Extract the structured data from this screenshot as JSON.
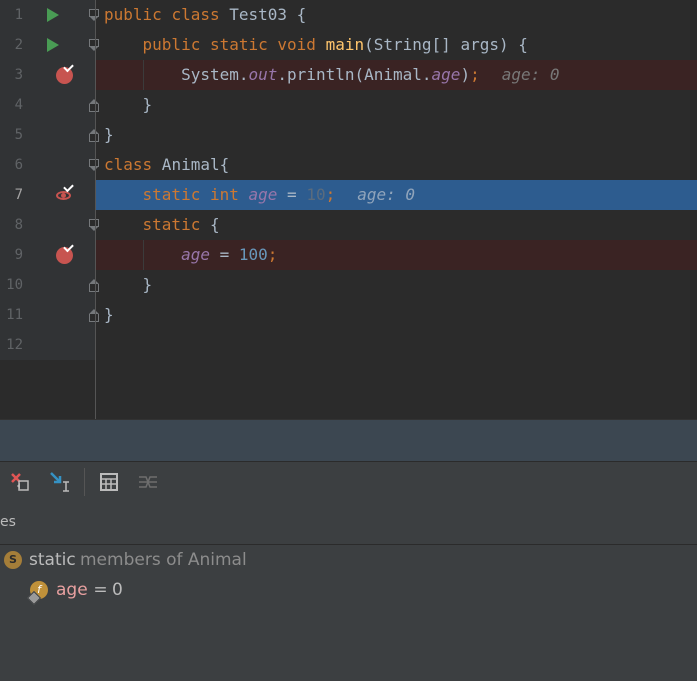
{
  "editor": {
    "lines": [
      {
        "n": "1",
        "tokens": [
          [
            "kw",
            "public"
          ],
          [
            "p",
            " "
          ],
          [
            "kw",
            "class"
          ],
          [
            "p",
            " Test03 {"
          ]
        ]
      },
      {
        "n": "2",
        "tokens": [
          [
            "p",
            "    "
          ],
          [
            "kw",
            "public"
          ],
          [
            "p",
            " "
          ],
          [
            "kw",
            "static"
          ],
          [
            "p",
            " "
          ],
          [
            "kw",
            "void"
          ],
          [
            "p",
            " "
          ],
          [
            "fn",
            "main"
          ],
          [
            "p",
            "(String[] args) {"
          ]
        ]
      },
      {
        "n": "3",
        "tokens": [
          [
            "p",
            "        System."
          ],
          [
            "st",
            "out"
          ],
          [
            "p",
            ".println(Animal."
          ],
          [
            "st",
            "age"
          ],
          [
            "p",
            ")"
          ],
          [
            "kw",
            ";"
          ]
        ],
        "inline": "age: 0"
      },
      {
        "n": "4",
        "tokens": [
          [
            "p",
            "    }"
          ]
        ]
      },
      {
        "n": "5",
        "tokens": [
          [
            "p",
            "}"
          ]
        ]
      },
      {
        "n": "6",
        "tokens": [
          [
            "kw",
            "class"
          ],
          [
            "p",
            " Animal{"
          ]
        ]
      },
      {
        "n": "7",
        "tokens": [
          [
            "p",
            "    "
          ],
          [
            "kw",
            "static"
          ],
          [
            "p",
            " "
          ],
          [
            "kw",
            "int"
          ],
          [
            "p",
            " "
          ],
          [
            "st",
            "age"
          ],
          [
            "p",
            " = "
          ],
          [
            "dim",
            "10"
          ],
          [
            "kw",
            ";"
          ]
        ],
        "inline": "age: 0"
      },
      {
        "n": "8",
        "tokens": [
          [
            "p",
            "    "
          ],
          [
            "kw",
            "static"
          ],
          [
            "p",
            " {"
          ]
        ]
      },
      {
        "n": "9",
        "tokens": [
          [
            "p",
            "        "
          ],
          [
            "st",
            "age"
          ],
          [
            "p",
            " = "
          ],
          [
            "num",
            "100"
          ],
          [
            "kw",
            ";"
          ]
        ]
      },
      {
        "n": "10",
        "tokens": [
          [
            "p",
            "    }"
          ]
        ]
      },
      {
        "n": "11",
        "tokens": [
          [
            "p",
            "}"
          ]
        ]
      },
      {
        "n": "12",
        "tokens": []
      }
    ]
  },
  "variables_panel": {
    "header_label": "es",
    "group": {
      "badge": "S",
      "keyword": "static",
      "label": "members of Animal"
    },
    "field": {
      "badge": "f",
      "name": "age",
      "equals": " = ",
      "value": "0"
    }
  },
  "colors": {
    "background": "#2b2b2b",
    "keyword": "#cc7832",
    "method": "#ffc66d",
    "static_field": "#9876aa",
    "number": "#6897bb",
    "breakpoint": "#c75450",
    "execution_line": "#2d5c8f",
    "run_arrow": "#499c54"
  }
}
